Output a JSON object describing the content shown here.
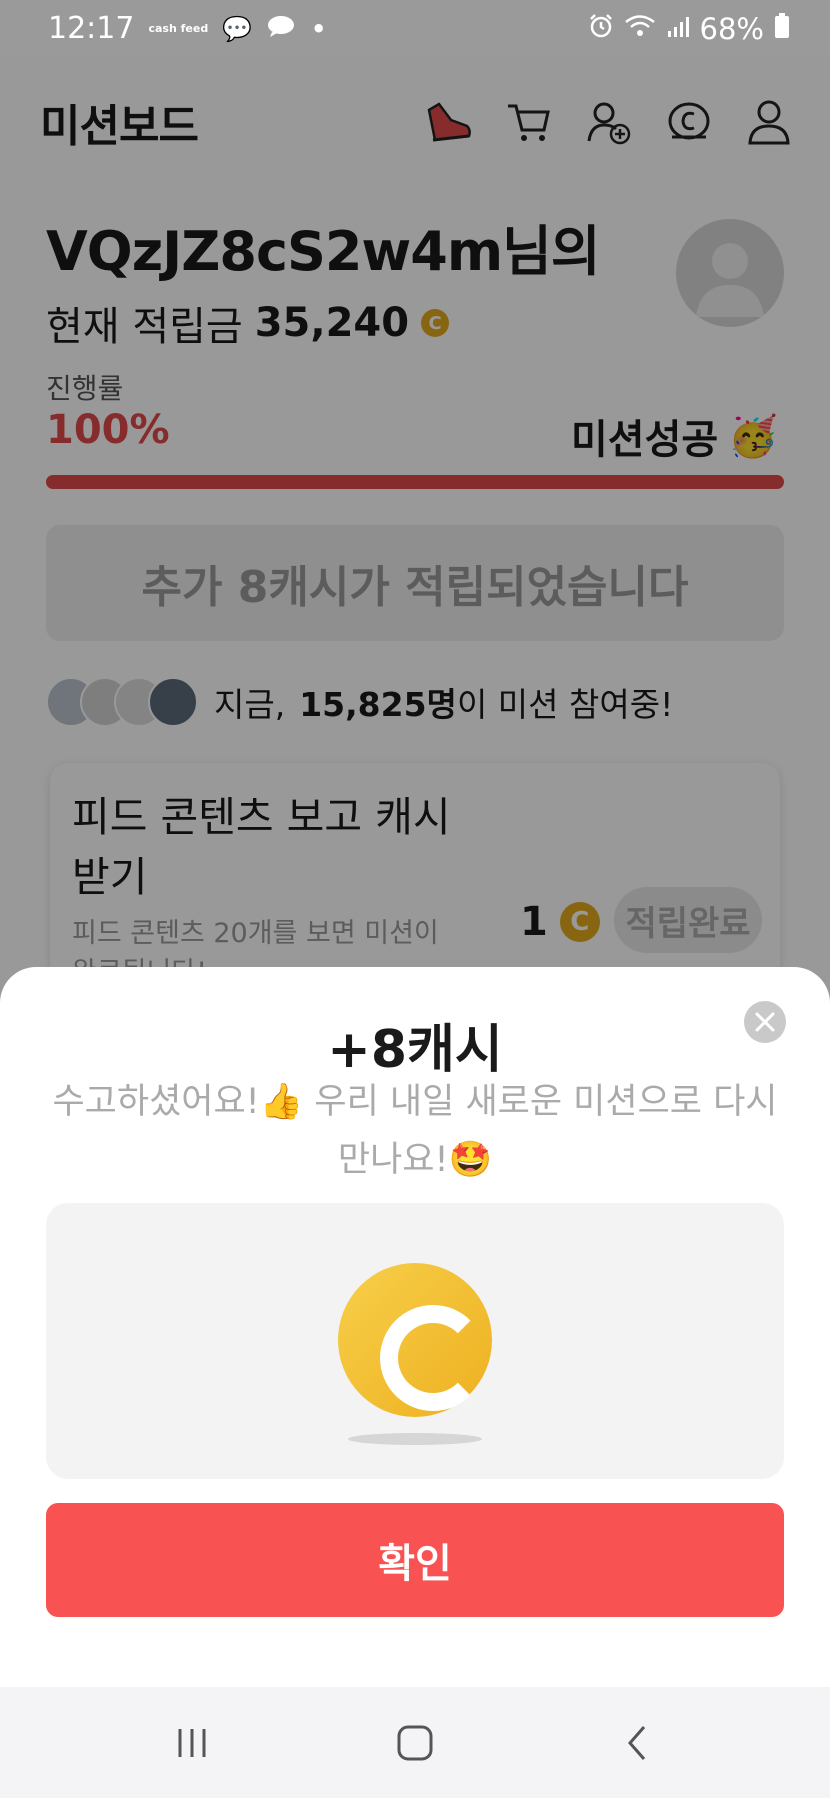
{
  "status_bar": {
    "time": "12:17",
    "app_mini_label": "cash feed",
    "battery": "68%"
  },
  "header": {
    "title": "미션보드",
    "icons": [
      "running-shoe-icon",
      "cart-icon",
      "add-friend-icon",
      "cash-coin-icon",
      "profile-icon"
    ]
  },
  "user": {
    "name": "VQzJZ8cS2w4m님의",
    "balance_label": "현재 적립금",
    "balance": "35,240"
  },
  "progress": {
    "label": "진행률",
    "value": "100%",
    "percent": 100,
    "status": "미션성공"
  },
  "bonus_banner": "추가 8캐시가 적립되었습니다",
  "participants": {
    "prefix": "지금,",
    "count": "15,825명",
    "suffix": "이 미션 참여중!"
  },
  "mission_card": {
    "title": "피드 콘텐츠 보고 캐시 받기",
    "description": "피드 콘텐츠 20개를 보면 미션이 완료됩니다!",
    "reward": "1",
    "status_button": "적립완료"
  },
  "sheet": {
    "title": "+8캐시",
    "message": "수고하셨어요!👍 우리 내일 새로운 미션으로 다시 만나요!🤩",
    "confirm_label": "확인"
  },
  "colors": {
    "accent_red": "#f85252",
    "progress_red": "#e24a4a",
    "coin_gold": "#eeb020"
  }
}
